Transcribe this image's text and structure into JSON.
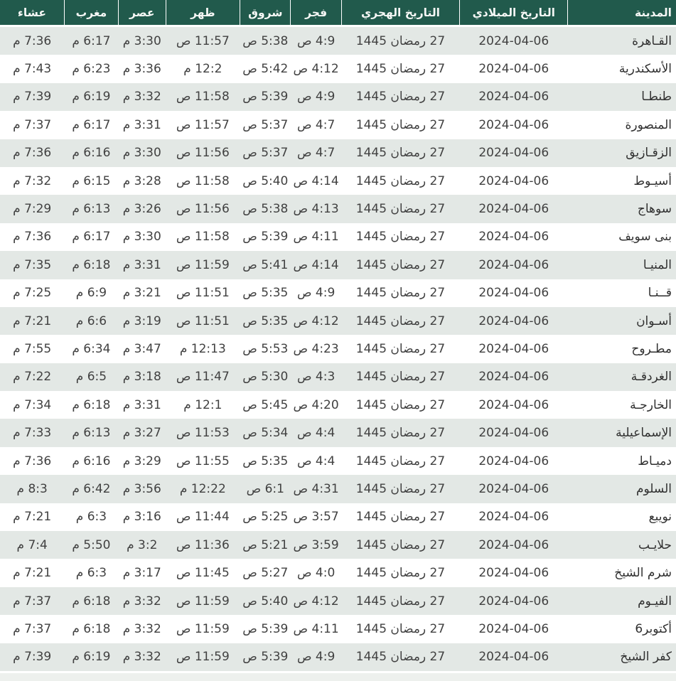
{
  "table": {
    "columns": [
      {
        "key": "city",
        "label": "المدينة"
      },
      {
        "key": "gregorian-date",
        "label": "التاريخ الميلادي"
      },
      {
        "key": "hijri-date",
        "label": "التاريخ الهجري"
      },
      {
        "key": "fajr",
        "label": "فجر"
      },
      {
        "key": "sunrise",
        "label": "شروق"
      },
      {
        "key": "dhuhr",
        "label": "ظهر"
      },
      {
        "key": "asr",
        "label": "عصر"
      },
      {
        "key": "maghrib",
        "label": "مغرب"
      },
      {
        "key": "isha",
        "label": "عشاء"
      }
    ],
    "rows": [
      {
        "cells": [
          "القـاهرة",
          "2024-04-06",
          "27 رمضان 1445",
          "4:9 ص",
          "5:38 ص",
          "11:57 ص",
          "3:30 م",
          "6:17 م",
          "7:36 م"
        ]
      },
      {
        "cells": [
          "الأسكندرية",
          "2024-04-06",
          "27 رمضان 1445",
          "4:12 ص",
          "5:42 ص",
          "12:2 م",
          "3:36 م",
          "6:23 م",
          "7:43 م"
        ]
      },
      {
        "cells": [
          "طنطـا",
          "2024-04-06",
          "27 رمضان 1445",
          "4:9 ص",
          "5:39 ص",
          "11:58 ص",
          "3:32 م",
          "6:19 م",
          "7:39 م"
        ]
      },
      {
        "cells": [
          "المنصورة",
          "2024-04-06",
          "27 رمضان 1445",
          "4:7 ص",
          "5:37 ص",
          "11:57 ص",
          "3:31 م",
          "6:17 م",
          "7:37 م"
        ]
      },
      {
        "cells": [
          "الزقـازيق",
          "2024-04-06",
          "27 رمضان 1445",
          "4:7 ص",
          "5:37 ص",
          "11:56 ص",
          "3:30 م",
          "6:16 م",
          "7:36 م"
        ]
      },
      {
        "cells": [
          "أسيـوط",
          "2024-04-06",
          "27 رمضان 1445",
          "4:14 ص",
          "5:40 ص",
          "11:58 ص",
          "3:28 م",
          "6:15 م",
          "7:32 م"
        ]
      },
      {
        "cells": [
          "سوهاج",
          "2024-04-06",
          "27 رمضان 1445",
          "4:13 ص",
          "5:38 ص",
          "11:56 ص",
          "3:26 م",
          "6:13 م",
          "7:29 م"
        ]
      },
      {
        "cells": [
          "بنى سويف",
          "2024-04-06",
          "27 رمضان 1445",
          "4:11 ص",
          "5:39 ص",
          "11:58 ص",
          "3:30 م",
          "6:17 م",
          "7:36 م"
        ]
      },
      {
        "cells": [
          "المنيـا",
          "2024-04-06",
          "27 رمضان 1445",
          "4:14 ص",
          "5:41 ص",
          "11:59 ص",
          "3:31 م",
          "6:18 م",
          "7:35 م"
        ]
      },
      {
        "cells": [
          "قــنـا",
          "2024-04-06",
          "27 رمضان 1445",
          "4:9 ص",
          "5:35 ص",
          "11:51 ص",
          "3:21 م",
          "6:9 م",
          "7:25 م"
        ]
      },
      {
        "cells": [
          "أسـوان",
          "2024-04-06",
          "27 رمضان 1445",
          "4:12 ص",
          "5:35 ص",
          "11:51 ص",
          "3:19 م",
          "6:6 م",
          "7:21 م"
        ]
      },
      {
        "cells": [
          "مطـروح",
          "2024-04-06",
          "27 رمضان 1445",
          "4:23 ص",
          "5:53 ص",
          "12:13 م",
          "3:47 م",
          "6:34 م",
          "7:55 م"
        ]
      },
      {
        "cells": [
          "الغردقـة",
          "2024-04-06",
          "27 رمضان 1445",
          "4:3 ص",
          "5:30 ص",
          "11:47 ص",
          "3:18 م",
          "6:5 م",
          "7:22 م"
        ]
      },
      {
        "cells": [
          "الخارجـة",
          "2024-04-06",
          "27 رمضان 1445",
          "4:20 ص",
          "5:45 ص",
          "12:1 م",
          "3:31 م",
          "6:18 م",
          "7:34 م"
        ]
      },
      {
        "cells": [
          "الإسماعيلية",
          "2024-04-06",
          "27 رمضان 1445",
          "4:4 ص",
          "5:34 ص",
          "11:53 ص",
          "3:27 م",
          "6:13 م",
          "7:33 م"
        ]
      },
      {
        "cells": [
          "دميـاط",
          "2024-04-06",
          "27 رمضان 1445",
          "4:4 ص",
          "5:35 ص",
          "11:55 ص",
          "3:29 م",
          "6:16 م",
          "7:36 م"
        ]
      },
      {
        "cells": [
          "السلوم",
          "2024-04-06",
          "27 رمضان 1445",
          "4:31 ص",
          "6:1 ص",
          "12:22 م",
          "3:56 م",
          "6:42 م",
          "8:3 م"
        ]
      },
      {
        "cells": [
          "نويبع",
          "2024-04-06",
          "27 رمضان 1445",
          "3:57 ص",
          "5:25 ص",
          "11:44 ص",
          "3:16 م",
          "6:3 م",
          "7:21 م"
        ]
      },
      {
        "cells": [
          "حلايـب",
          "2024-04-06",
          "27 رمضان 1445",
          "3:59 ص",
          "5:21 ص",
          "11:36 ص",
          "3:2 م",
          "5:50 م",
          "7:4 م"
        ]
      },
      {
        "cells": [
          "شرم الشيخ",
          "2024-04-06",
          "27 رمضان 1445",
          "4:0 ص",
          "5:27 ص",
          "11:45 ص",
          "3:17 م",
          "6:3 م",
          "7:21 م"
        ]
      },
      {
        "cells": [
          "الفيـوم",
          "2024-04-06",
          "27 رمضان 1445",
          "4:12 ص",
          "5:40 ص",
          "11:59 ص",
          "3:32 م",
          "6:18 م",
          "7:37 م"
        ]
      },
      {
        "cells": [
          "أكتوبر6",
          "2024-04-06",
          "27 رمضان 1445",
          "4:11 ص",
          "5:39 ص",
          "11:59 ص",
          "3:32 م",
          "6:18 م",
          "7:37 م"
        ]
      },
      {
        "cells": [
          "كفر الشيخ",
          "2024-04-06",
          "27 رمضان 1445",
          "4:9 ص",
          "5:39 ص",
          "11:59 ص",
          "3:32 م",
          "6:19 م",
          "7:39 م"
        ]
      }
    ]
  },
  "colors": {
    "header_bg": "#215a4c",
    "header_text": "#f6f8f6",
    "row_alt_bg": "#e3e8e5",
    "row_bg": "#ffffff",
    "cell_text": "#414141",
    "city_text": "#303030"
  }
}
